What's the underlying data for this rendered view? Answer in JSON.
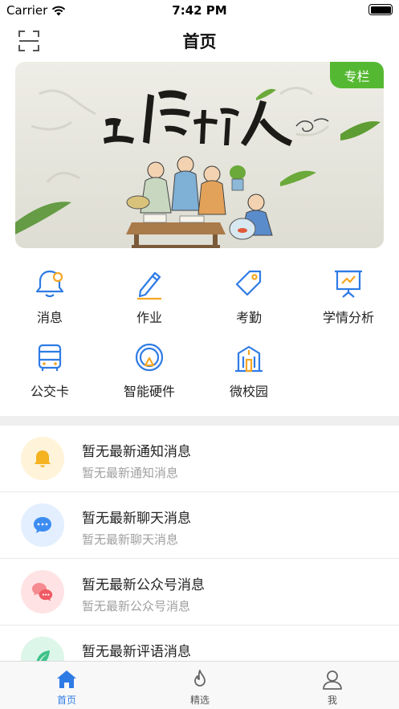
{
  "status_bar": {
    "carrier": "Carrier",
    "time": "7:42 PM"
  },
  "nav": {
    "title": "首页",
    "scan_icon": "scan-icon"
  },
  "banner": {
    "tag": "专栏",
    "image_title": "立德树人"
  },
  "grid": [
    {
      "label": "消息",
      "icon": "bell-icon"
    },
    {
      "label": "作业",
      "icon": "pencil-icon"
    },
    {
      "label": "考勤",
      "icon": "tag-icon"
    },
    {
      "label": "学情分析",
      "icon": "chart-board-icon"
    },
    {
      "label": "公交卡",
      "icon": "bus-icon"
    },
    {
      "label": "智能硬件",
      "icon": "device-icon"
    },
    {
      "label": "微校园",
      "icon": "building-icon"
    }
  ],
  "messages": [
    {
      "title": "暂无最新通知消息",
      "subtitle": "暂无最新通知消息",
      "icon": "bell-icon",
      "color": "#f5b321",
      "bg": "#fff3d9"
    },
    {
      "title": "暂无最新聊天消息",
      "subtitle": "暂无最新聊天消息",
      "icon": "chat-icon",
      "color": "#3d8cf0",
      "bg": "#e3efff"
    },
    {
      "title": "暂无最新公众号消息",
      "subtitle": "暂无最新公众号消息",
      "icon": "chat-bubbles-icon",
      "color": "#f05a63",
      "bg": "#ffe3e4"
    },
    {
      "title": "暂无最新评语消息",
      "subtitle": "",
      "icon": "feather-icon",
      "color": "#3fc28a",
      "bg": "#ddf6ea"
    }
  ],
  "tabs": [
    {
      "label": "首页",
      "icon": "home-icon",
      "active": true
    },
    {
      "label": "精选",
      "icon": "flame-icon",
      "active": false
    },
    {
      "label": "我",
      "icon": "user-icon",
      "active": false
    }
  ],
  "colors": {
    "accent": "#2f7be5",
    "icon_blue": "#2f7be5",
    "icon_orange": "#f5a623",
    "banner_tag": "#55b832"
  }
}
